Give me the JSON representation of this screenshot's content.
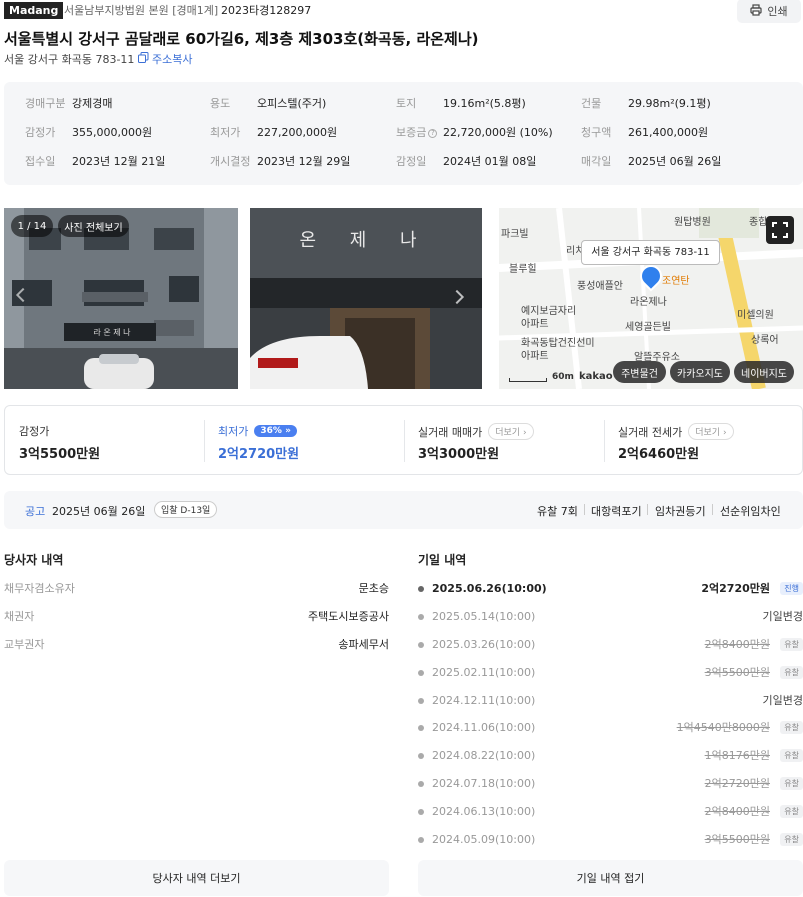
{
  "header": {
    "logo": "Madang",
    "court": "서울남부지방법원 본원 [경매1계]",
    "case_no": "2023타경128297",
    "print_label": "인쇄"
  },
  "title": "서울특별시 강서구 곰달래로 60가길6, 제3층 제303호(화곡동, 라온제나)",
  "sub_address": "서울 강서구 화곡동 783-11",
  "copy_label": "주소복사",
  "info": [
    {
      "label": "경매구분",
      "value": "강제경매"
    },
    {
      "label": "용도",
      "value": "오피스텔(주거)"
    },
    {
      "label": "토지",
      "value": "19.16m²(5.8평)"
    },
    {
      "label": "건물",
      "value": "29.98m²(9.1평)"
    },
    {
      "label": "감정가",
      "value": "355,000,000원"
    },
    {
      "label": "최저가",
      "value": "227,200,000원"
    },
    {
      "label": "보증금",
      "value": "22,720,000원 (10%)"
    },
    {
      "label": "청구액",
      "value": "261,400,000원"
    },
    {
      "label": "접수일",
      "value": "2023년 12월 21일"
    },
    {
      "label": "개시결정",
      "value": "2023년 12월 29일"
    },
    {
      "label": "감정일",
      "value": "2024년 01월 08일"
    },
    {
      "label": "매각일",
      "value": "2025년 06월 26일"
    }
  ],
  "photos": {
    "counter": "1 / 14",
    "view_all": "사진 전체보기",
    "sign_text": "라 온 제 나",
    "sign_big": "온  제  나"
  },
  "map": {
    "tooltip": "서울 강서구 화곡동 783-11",
    "labels": [
      "원탑병원",
      "종합병원",
      "파크빌",
      "블루힐",
      "풍성애플안",
      "라온제나",
      "조연탄",
      "예지보금자리",
      "아파트",
      "세영골든빌",
      "미셀의원",
      "화곡동탑건진선미",
      "아파트",
      "알뜰주유소",
      "상록어",
      "리치"
    ],
    "scale": "60m",
    "brand": "kakao",
    "buttons": [
      "주변물건",
      "카카오지도",
      "네이버지도"
    ]
  },
  "prices": [
    {
      "label": "감정가",
      "value": "3억5500만원",
      "badge": "",
      "more": ""
    },
    {
      "label": "최저가",
      "value": "2억2720만원",
      "badge": "36%",
      "more": ""
    },
    {
      "label": "실거래 매매가",
      "value": "3억3000만원",
      "badge": "",
      "more": "더보기"
    },
    {
      "label": "실거래 전세가",
      "value": "2억6460만원",
      "badge": "",
      "more": "더보기"
    }
  ],
  "notice": {
    "label": "공고",
    "date": "2025년 06월 26일",
    "dday": "입찰 D-13일",
    "tags": [
      "유찰 7회",
      "대항력포기",
      "임차권등기",
      "선순위임차인"
    ]
  },
  "parties": {
    "title": "당사자 내역",
    "rows": [
      {
        "k": "채무자겸소유자",
        "v": "문초승"
      },
      {
        "k": "채권자",
        "v": "주택도시보증공사"
      },
      {
        "k": "교부권자",
        "v": "송파세무서"
      }
    ],
    "more_label": "당사자 내역 더보기"
  },
  "history": {
    "title": "기일 내역",
    "rows": [
      {
        "date": "2025.06.26(10:00)",
        "amount": "2억2720만원",
        "status": "진행"
      },
      {
        "date": "2025.05.14(10:00)",
        "amount": "기일변경",
        "status": ""
      },
      {
        "date": "2025.03.26(10:00)",
        "amount": "2억8400만원",
        "status": "유찰"
      },
      {
        "date": "2025.02.11(10:00)",
        "amount": "3억5500만원",
        "status": "유찰"
      },
      {
        "date": "2024.12.11(10:00)",
        "amount": "기일변경",
        "status": ""
      },
      {
        "date": "2024.11.06(10:00)",
        "amount": "1억4540만8000원",
        "status": "유찰"
      },
      {
        "date": "2024.08.22(10:00)",
        "amount": "1억8176만원",
        "status": "유찰"
      },
      {
        "date": "2024.07.18(10:00)",
        "amount": "2억2720만원",
        "status": "유찰"
      },
      {
        "date": "2024.06.13(10:00)",
        "amount": "2억8400만원",
        "status": "유찰"
      },
      {
        "date": "2024.05.09(10:00)",
        "amount": "3억5500만원",
        "status": "유찰"
      }
    ],
    "fold_label": "기일 내역 접기"
  },
  "colors": {
    "accent": "#3b6fd6",
    "badge": "#4a7ff0",
    "map_pin": "#2f80ed"
  }
}
